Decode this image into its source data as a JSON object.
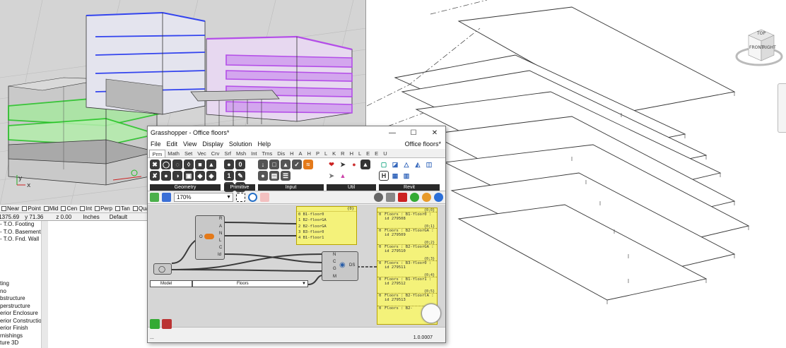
{
  "rhino": {
    "axes": {
      "x": "x",
      "y": "y"
    },
    "osnap": [
      {
        "label": "Near",
        "checked": false
      },
      {
        "label": "Point",
        "checked": false
      },
      {
        "label": "Mid",
        "checked": false
      },
      {
        "label": "Cen",
        "checked": false
      },
      {
        "label": "Int",
        "checked": false
      },
      {
        "label": "Perp",
        "checked": false
      },
      {
        "label": "Tan",
        "checked": false
      },
      {
        "label": "Quad",
        "checked": false
      }
    ],
    "status": {
      "x": "x 1375.69",
      "y": "y 71.36",
      "z": "z 0.00",
      "units": "Inches",
      "layer": "Default"
    }
  },
  "revit_browser": {
    "items": [
      "- T.O. Footing",
      "- T.O. Basement",
      "- T.O. Fnd. Wall",
      "",
      "",
      "",
      "",
      "",
      "ting",
      "no",
      "bstructure",
      "perstructure",
      "erior Enclosure",
      "erior Constructio",
      "erior Finish",
      "rnishings",
      "ture 3D"
    ]
  },
  "revit": {
    "viewcube": {
      "front": "FRONT",
      "right": "RIGHT",
      "top": "TOP"
    }
  },
  "gh": {
    "title": "Grasshopper - Office floors*",
    "menu": [
      "File",
      "Edit",
      "View",
      "Display",
      "Solution",
      "Help"
    ],
    "doc_name": "Office floors*",
    "tabs": [
      "Prm",
      "Math",
      "Set",
      "Vec",
      "Crv",
      "Srf",
      "Msh",
      "Int",
      "Trns",
      "Dis",
      "H",
      "A",
      "H",
      "P",
      "L",
      "K",
      "R",
      "H",
      "L",
      "E",
      "E",
      "U"
    ],
    "ribbon_groups": [
      "Geometry",
      "Primitive",
      "Input",
      "Util",
      "Revit"
    ],
    "zoom": "170%",
    "components": {
      "rank_ports": [
        "R",
        "A",
        "N",
        "L",
        "C",
        "Id"
      ],
      "o_label": "O",
      "ds_ports": [
        "N",
        "C",
        "G",
        "M"
      ],
      "ds_label": "DS",
      "dropdown_left": "Model",
      "dropdown_right": "Floors"
    },
    "floor_panel": {
      "header": "{0}",
      "rows": [
        "0 B1-floor0",
        "1 B2-floorGA",
        "2 B2-floorGA",
        "3 B3-floor0",
        "4 B1-floor1"
      ]
    },
    "result_panel": {
      "items": [
        {
          "path": "{0;0}",
          "index": "0",
          "text": "Floors : B1-floor0 : id 279508"
        },
        {
          "path": "{0;1}",
          "index": "0",
          "text": "Floors : B2-floorGA : id 279509"
        },
        {
          "path": "{0;2}",
          "index": "0",
          "text": "Floors : B2-floorGA : id 279510"
        },
        {
          "path": "{0;3}",
          "index": "0",
          "text": "Floors : B3-floor0 : id 279511"
        },
        {
          "path": "{0;4}",
          "index": "0",
          "text": "Floors : B1-floor1 : id 279512"
        },
        {
          "path": "{0;5}",
          "index": "0",
          "text": "Floors : B2-floorlA : id 279513"
        },
        {
          "path": "",
          "index": "0",
          "text": "Floors : B2-"
        }
      ]
    },
    "status": {
      "left": "...",
      "version": "1.0.0007"
    }
  }
}
